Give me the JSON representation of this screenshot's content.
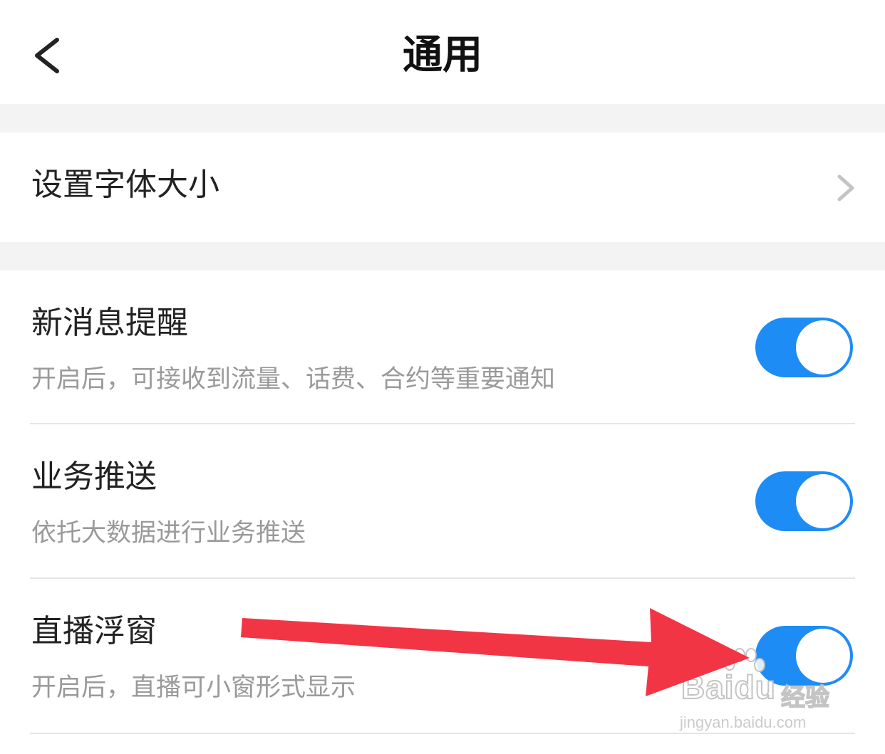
{
  "header": {
    "title": "通用",
    "back_icon": "chevron-left-icon"
  },
  "sections": {
    "font_size": {
      "label": "设置字体大小",
      "chevron_icon": "chevron-right-icon"
    },
    "settings": [
      {
        "label": "新消息提醒",
        "description": "开启后，可接收到流量、话费、合约等重要通知",
        "enabled": true
      },
      {
        "label": "业务推送",
        "description": "依托大数据进行业务推送",
        "enabled": true
      },
      {
        "label": "直播浮窗",
        "description": "开启后，直播可小窗形式显示",
        "enabled": true
      }
    ]
  },
  "annotation": {
    "arrow_color": "#f23545"
  },
  "watermark": {
    "brand": "Bai",
    "brand_suffix": "du",
    "cn_text": "经验",
    "url": "jingyan.baidu.com"
  },
  "colors": {
    "toggle_on": "#1e8cf5",
    "section_gap": "#f3f3f3",
    "description": "#9a9a9a"
  }
}
